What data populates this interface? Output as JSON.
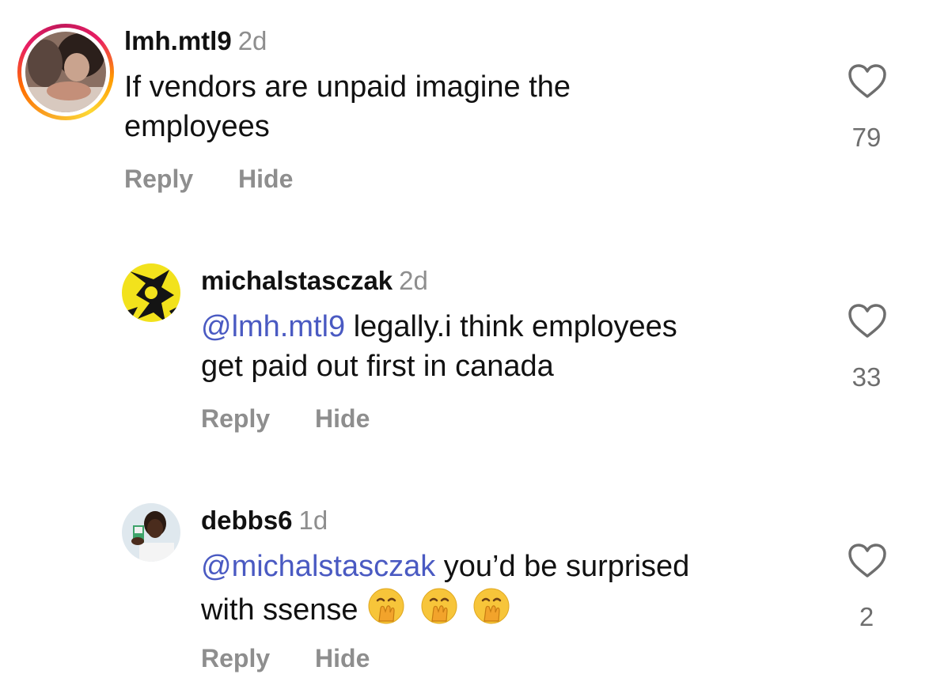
{
  "comments": [
    {
      "username": "lmh.mtl9",
      "time": "2d",
      "mention": "",
      "text_line1": "If vendors are unpaid imagine the",
      "text_line2": "employees",
      "likes": "79",
      "reply_label": "Reply",
      "hide_label": "Hide",
      "story_ring": true
    },
    {
      "username": "michalstasczak",
      "time": "2d",
      "mention": "@lmh.mtl9",
      "text_line1": " legally.i think employees",
      "text_line2": "get paid out first in canada",
      "likes": "33",
      "reply_label": "Reply",
      "hide_label": "Hide"
    },
    {
      "username": "debbs6",
      "time": "1d",
      "mention": "@michalstasczak",
      "text_line1": " you’d be surprised",
      "text_line2": "with ssense",
      "emojis": [
        "face-with-hand-over-mouth",
        "face-with-hand-over-mouth",
        "face-with-hand-over-mouth"
      ],
      "likes": "2",
      "reply_label": "Reply",
      "hide_label": "Hide"
    }
  ],
  "colors": {
    "mention": "#4a5ac2",
    "secondary_text": "#8e8e8e",
    "count_text": "#6e6e6e"
  }
}
